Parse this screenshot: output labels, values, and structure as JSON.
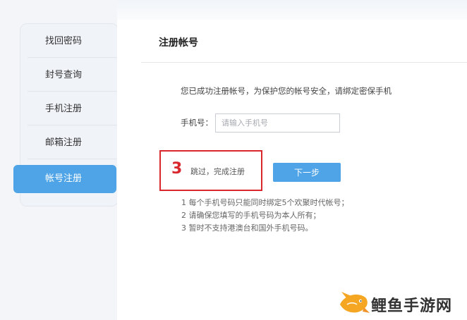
{
  "sidebar": {
    "items": [
      {
        "label": "找回密码"
      },
      {
        "label": "封号查询"
      },
      {
        "label": "手机注册"
      },
      {
        "label": "邮箱注册"
      },
      {
        "label": "帐号注册",
        "active": true
      }
    ]
  },
  "main": {
    "title": "注册帐号",
    "notice": "您已成功注册帐号，为保护您的帐号安全，请绑定密保手机",
    "phone_label": "手机号：",
    "phone_placeholder": "请输入手机号",
    "phone_value": "",
    "step_number": "3",
    "skip_label": "跳过，完成注册",
    "next_label": "下一步",
    "notes": [
      "1 每个手机号码只能同时绑定5个欢聚时代帐号；",
      "2 请确保您填写的手机号码为本人所有；",
      "3 暂时不支持港澳台和国外手机号码。"
    ]
  },
  "watermark": {
    "text": "鲤鱼手游网",
    "icon": "carp-fish-logo"
  },
  "colors": {
    "accent": "#4ea4e6",
    "highlight": "#d9272e",
    "watermark_fish": "#f5a623"
  }
}
